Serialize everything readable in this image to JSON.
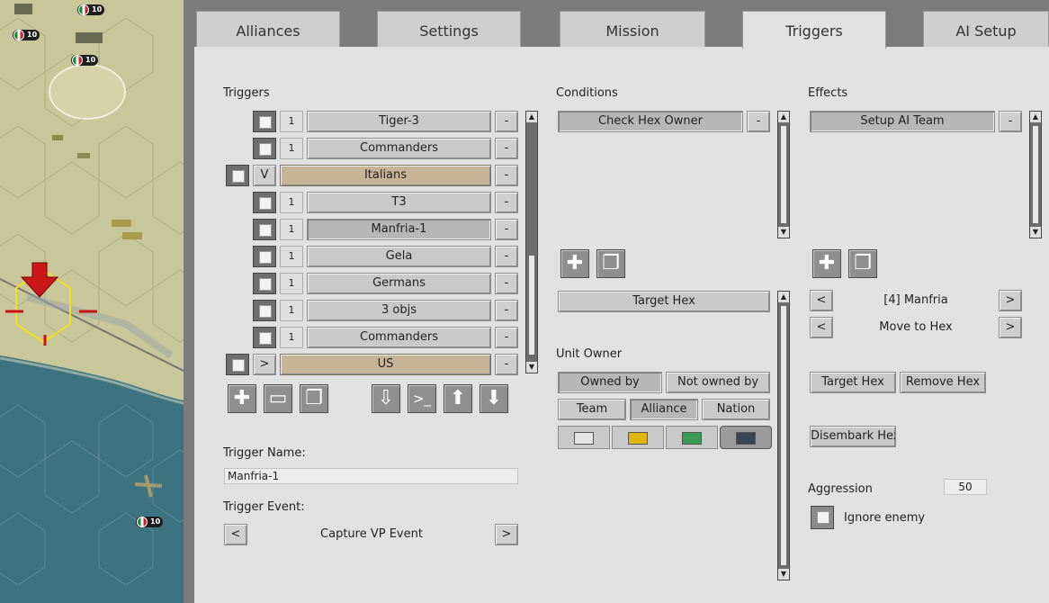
{
  "colors": {
    "tan": "#c6b497",
    "panel": "#e1e1e1",
    "sea": "#3d7380",
    "land": "#c8c79a"
  },
  "map": {
    "badges": [
      "10",
      "10",
      "10",
      "10"
    ]
  },
  "tabs": [
    "Alliances",
    "Settings",
    "Mission",
    "Triggers",
    "AI Setup"
  ],
  "triggers": {
    "title": "Triggers",
    "rows": [
      {
        "num": "1",
        "label": "Tiger-3",
        "del": "-"
      },
      {
        "num": "1",
        "label": "Commanders",
        "del": "-"
      },
      {
        "num": "V",
        "label": "Italians",
        "del": "-"
      },
      {
        "num": "1",
        "label": "T3",
        "del": "-"
      },
      {
        "num": "1",
        "label": "Manfria-1",
        "del": "-"
      },
      {
        "num": "1",
        "label": "Gela",
        "del": "-"
      },
      {
        "num": "1",
        "label": "Germans",
        "del": "-"
      },
      {
        "num": "1",
        "label": "3 objs",
        "del": "-"
      },
      {
        "num": "1",
        "label": "Commanders",
        "del": "-"
      },
      {
        "num": ">",
        "label": "US",
        "del": "-"
      }
    ],
    "toolbar_icons": [
      "plus-icon",
      "folder-icon",
      "copy-icon",
      "import-icon",
      "console-icon",
      "arrow-up-icon",
      "arrow-down-icon"
    ],
    "name_label": "Trigger Name:",
    "name_value": "Manfria-1",
    "event_label": "Trigger Event:",
    "event_value": "Capture VP Event",
    "prev": "<",
    "next": ">"
  },
  "conditions": {
    "title": "Conditions",
    "items": [
      {
        "label": "Check Hex Owner",
        "del": "-"
      }
    ],
    "target_hex": "Target Hex",
    "unit_owner_label": "Unit Owner",
    "owned_by": "Owned by",
    "not_owned_by": "Not owned by",
    "team": "Team",
    "alliance": "Alliance",
    "nation": "Nation",
    "swatches": [
      "#e4e4e4",
      "#e2b30c",
      "#3a9a52",
      "#3b4356"
    ]
  },
  "effects": {
    "title": "Effects",
    "items": [
      {
        "label": "Setup AI Team",
        "del": "-"
      }
    ],
    "target_value": "[4] Manfria",
    "action_value": "Move to Hex",
    "prev": "<",
    "next": ">",
    "target_hex": "Target Hex",
    "remove_hex": "Remove Hex",
    "disembark_hex": "Disembark Hex",
    "aggression_label": "Aggression",
    "aggression_value": "50",
    "ignore_enemy": "Ignore enemy"
  }
}
